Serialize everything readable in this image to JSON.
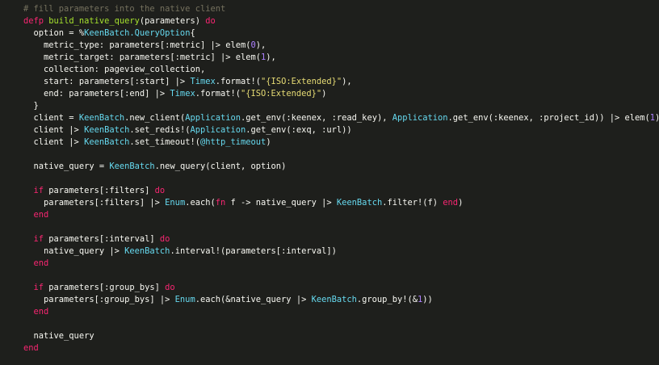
{
  "editor": {
    "language": "elixir",
    "theme_colors": {
      "background": "#1e1f1c",
      "default": "#f8f8f2",
      "comment": "#75715e",
      "keyword": "#f92672",
      "module": "#66d9ef",
      "string": "#e6db74",
      "number": "#ae81ff",
      "function": "#a6e22e"
    },
    "lines": [
      [
        [
          "comment",
          "# fill parameters into the native client"
        ]
      ],
      [
        [
          "keyword",
          "defp"
        ],
        [
          "default",
          " "
        ],
        [
          "function",
          "build_native_query"
        ],
        [
          "default",
          "(parameters) "
        ],
        [
          "keyword",
          "do"
        ]
      ],
      [
        [
          "default",
          "  option = %"
        ],
        [
          "module",
          "KeenBatch.QueryOption"
        ],
        [
          "default",
          "{"
        ]
      ],
      [
        [
          "default",
          "    metric_type: parameters[:metric] |> elem("
        ],
        [
          "number",
          "0"
        ],
        [
          "default",
          "),"
        ]
      ],
      [
        [
          "default",
          "    metric_target: parameters[:metric] |> elem("
        ],
        [
          "number",
          "1"
        ],
        [
          "default",
          "),"
        ]
      ],
      [
        [
          "default",
          "    collection: pageview_collection,"
        ]
      ],
      [
        [
          "default",
          "    start: parameters[:start] |> "
        ],
        [
          "module",
          "Timex"
        ],
        [
          "default",
          ".format!("
        ],
        [
          "string",
          "\"{ISO:Extended}\""
        ],
        [
          "default",
          "),"
        ]
      ],
      [
        [
          "default",
          "    end: parameters[:end] |> "
        ],
        [
          "module",
          "Timex"
        ],
        [
          "default",
          ".format!("
        ],
        [
          "string",
          "\"{ISO:Extended}\""
        ],
        [
          "default",
          ")"
        ]
      ],
      [
        [
          "default",
          "  }"
        ]
      ],
      [
        [
          "default",
          "  client = "
        ],
        [
          "module",
          "KeenBatch"
        ],
        [
          "default",
          ".new_client("
        ],
        [
          "module",
          "Application"
        ],
        [
          "default",
          ".get_env(:keenex, :read_key), "
        ],
        [
          "module",
          "Application"
        ],
        [
          "default",
          ".get_env(:keenex, :project_id)) |> elem("
        ],
        [
          "number",
          "1"
        ],
        [
          "default",
          ")"
        ]
      ],
      [
        [
          "default",
          "  client |> "
        ],
        [
          "module",
          "KeenBatch"
        ],
        [
          "default",
          ".set_redis!("
        ],
        [
          "module",
          "Application"
        ],
        [
          "default",
          ".get_env(:exq, :url))"
        ]
      ],
      [
        [
          "default",
          "  client |> "
        ],
        [
          "module",
          "KeenBatch"
        ],
        [
          "default",
          ".set_timeout!("
        ],
        [
          "module",
          "@http_timeout"
        ],
        [
          "default",
          ")"
        ]
      ],
      [],
      [
        [
          "default",
          "  native_query = "
        ],
        [
          "module",
          "KeenBatch"
        ],
        [
          "default",
          ".new_query(client, option)"
        ]
      ],
      [],
      [
        [
          "default",
          "  "
        ],
        [
          "keyword",
          "if"
        ],
        [
          "default",
          " parameters[:filters] "
        ],
        [
          "keyword",
          "do"
        ]
      ],
      [
        [
          "default",
          "    parameters[:filters] |> "
        ],
        [
          "module",
          "Enum"
        ],
        [
          "default",
          ".each("
        ],
        [
          "keyword",
          "fn"
        ],
        [
          "default",
          " f -> native_query |> "
        ],
        [
          "module",
          "KeenBatch"
        ],
        [
          "default",
          ".filter!(f) "
        ],
        [
          "keyword",
          "end"
        ],
        [
          "default",
          ")"
        ]
      ],
      [
        [
          "default",
          "  "
        ],
        [
          "keyword",
          "end"
        ]
      ],
      [],
      [
        [
          "default",
          "  "
        ],
        [
          "keyword",
          "if"
        ],
        [
          "default",
          " parameters[:interval] "
        ],
        [
          "keyword",
          "do"
        ]
      ],
      [
        [
          "default",
          "    native_query |> "
        ],
        [
          "module",
          "KeenBatch"
        ],
        [
          "default",
          ".interval!(parameters[:interval])"
        ]
      ],
      [
        [
          "default",
          "  "
        ],
        [
          "keyword",
          "end"
        ]
      ],
      [],
      [
        [
          "default",
          "  "
        ],
        [
          "keyword",
          "if"
        ],
        [
          "default",
          " parameters[:group_bys] "
        ],
        [
          "keyword",
          "do"
        ]
      ],
      [
        [
          "default",
          "    parameters[:group_bys] |> "
        ],
        [
          "module",
          "Enum"
        ],
        [
          "default",
          ".each(&native_query |> "
        ],
        [
          "module",
          "KeenBatch"
        ],
        [
          "default",
          ".group_by!(&"
        ],
        [
          "number",
          "1"
        ],
        [
          "default",
          "))"
        ]
      ],
      [
        [
          "default",
          "  "
        ],
        [
          "keyword",
          "end"
        ]
      ],
      [],
      [
        [
          "default",
          "  native_query"
        ]
      ],
      [
        [
          "keyword",
          "end"
        ]
      ]
    ]
  }
}
